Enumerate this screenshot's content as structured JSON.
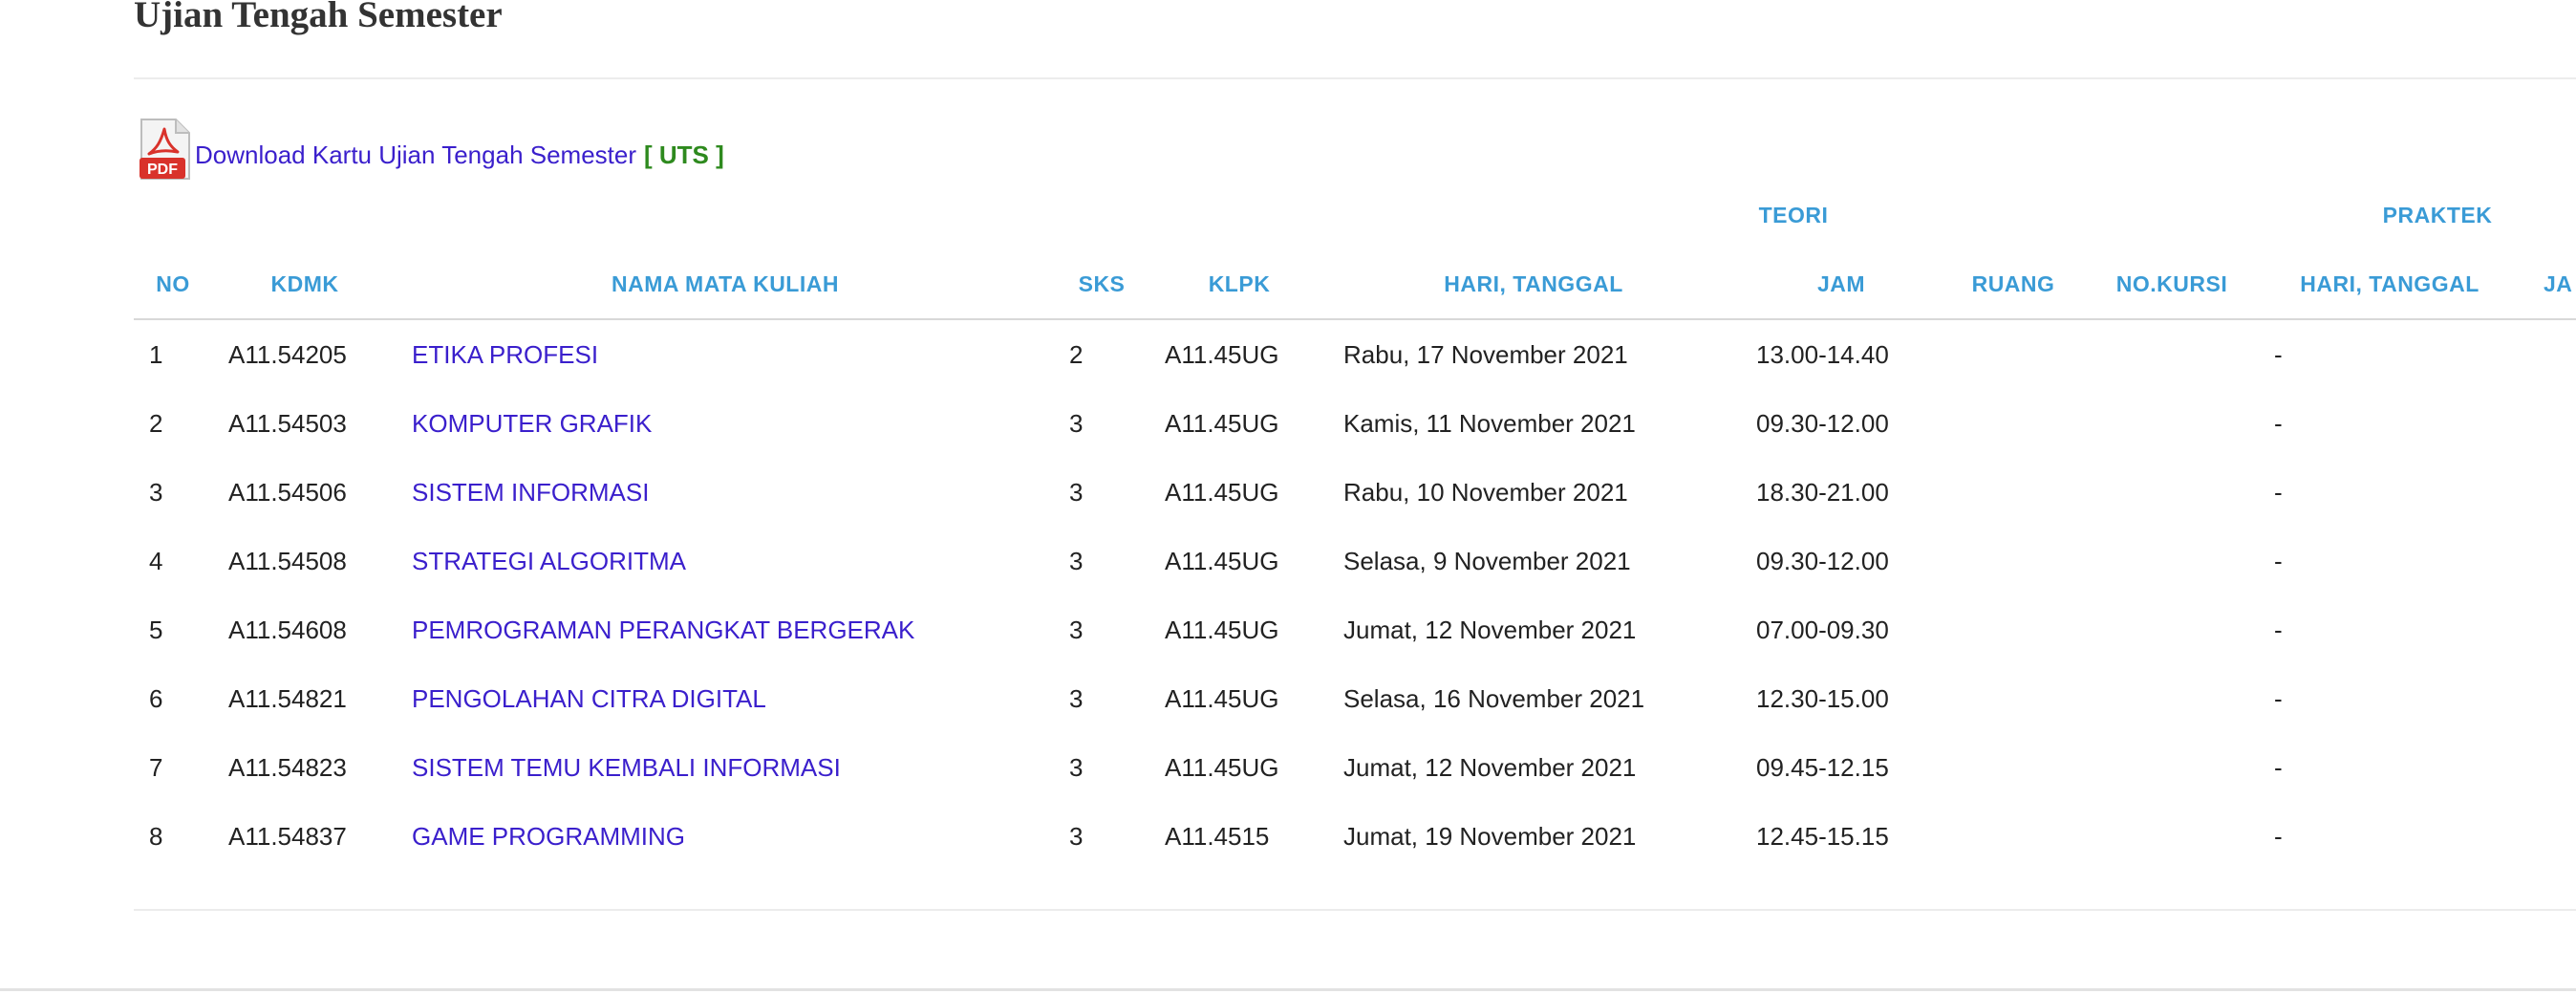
{
  "page": {
    "title": "Ujian Tengah Semester"
  },
  "download": {
    "icon": "pdf-file-icon",
    "icon_label": "PDF",
    "link_text": "Download Kartu Ujian Tengah Semester",
    "tag": "[ UTS ]"
  },
  "table": {
    "groups": {
      "teori": "TEORI",
      "praktek": "PRAKTEK"
    },
    "headers": {
      "no": "NO",
      "kdmk": "KDMK",
      "nama": "NAMA MATA KULIAH",
      "sks": "SKS",
      "klpk": "KLPK",
      "hari_teori": "HARI, TANGGAL",
      "jam_teori": "JAM",
      "ruang": "RUANG",
      "no_kursi": "NO.KURSI",
      "hari_praktek": "HARI, TANGGAL",
      "jam_praktek": "JA"
    },
    "rows": [
      {
        "no": "1",
        "kdmk": "A11.54205",
        "nama": "ETIKA PROFESI",
        "sks": "2",
        "klpk": "A11.45UG",
        "hari": "Rabu, 17 November 2021",
        "jam": "13.00-14.40",
        "praktek": "-"
      },
      {
        "no": "2",
        "kdmk": "A11.54503",
        "nama": "KOMPUTER GRAFIK",
        "sks": "3",
        "klpk": "A11.45UG",
        "hari": "Kamis, 11 November 2021",
        "jam": "09.30-12.00",
        "praktek": "-"
      },
      {
        "no": "3",
        "kdmk": "A11.54506",
        "nama": "SISTEM INFORMASI",
        "sks": "3",
        "klpk": "A11.45UG",
        "hari": "Rabu, 10 November 2021",
        "jam": "18.30-21.00",
        "praktek": "-"
      },
      {
        "no": "4",
        "kdmk": "A11.54508",
        "nama": "STRATEGI ALGORITMA",
        "sks": "3",
        "klpk": "A11.45UG",
        "hari": "Selasa, 9 November 2021",
        "jam": "09.30-12.00",
        "praktek": "-"
      },
      {
        "no": "5",
        "kdmk": "A11.54608",
        "nama": "PEMROGRAMAN PERANGKAT BERGERAK",
        "sks": "3",
        "klpk": "A11.45UG",
        "hari": "Jumat, 12 November 2021",
        "jam": "07.00-09.30",
        "praktek": "-"
      },
      {
        "no": "6",
        "kdmk": "A11.54821",
        "nama": "PENGOLAHAN CITRA DIGITAL",
        "sks": "3",
        "klpk": "A11.45UG",
        "hari": "Selasa, 16 November 2021",
        "jam": "12.30-15.00",
        "praktek": "-"
      },
      {
        "no": "7",
        "kdmk": "A11.54823",
        "nama": "SISTEM TEMU KEMBALI INFORMASI",
        "sks": "3",
        "klpk": "A11.45UG",
        "hari": "Jumat, 12 November 2021",
        "jam": "09.45-12.15",
        "praktek": "-"
      },
      {
        "no": "8",
        "kdmk": "A11.54837",
        "nama": "GAME PROGRAMMING",
        "sks": "3",
        "klpk": "A11.4515",
        "hari": "Jumat, 19 November 2021",
        "jam": "12.45-15.15",
        "praktek": "-"
      }
    ]
  }
}
